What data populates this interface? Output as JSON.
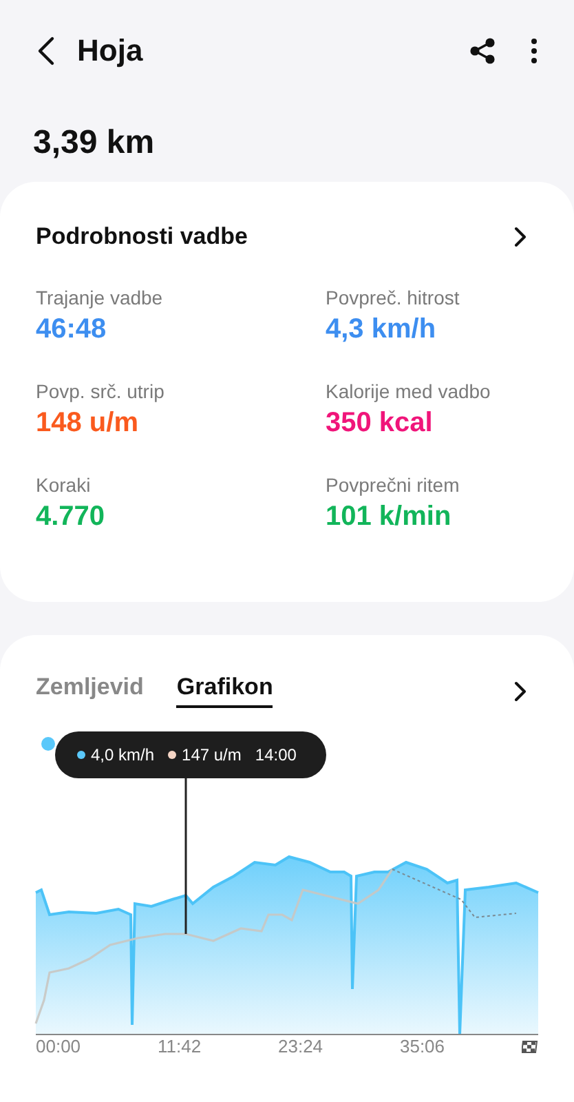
{
  "header": {
    "title": "Hoja"
  },
  "distance": "3,39 km",
  "details": {
    "title": "Podrobnosti vadbe",
    "stats": [
      {
        "label": "Trajanje vadbe",
        "value": "46:48",
        "color": "#3d8ef0"
      },
      {
        "label": "Povpreč. hitrost",
        "value": "4,3 km/h",
        "color": "#3d8ef0"
      },
      {
        "label": "Povp. srč. utrip",
        "value": "148 u/m",
        "color": "#fa5a1e"
      },
      {
        "label": "Kalorije med vadbo",
        "value": "350 kcal",
        "color": "#f0157a"
      },
      {
        "label": "Koraki",
        "value": "4.770",
        "color": "#12b55a"
      },
      {
        "label": "Povprečni ritem",
        "value": "101 k/min",
        "color": "#12b55a"
      }
    ]
  },
  "graph": {
    "tabs": [
      {
        "label": "Zemljevid",
        "selected": false
      },
      {
        "label": "Grafikon",
        "selected": true
      }
    ],
    "tooltip": [
      {
        "text": "4,0 km/h",
        "color": "#5ac8fa"
      },
      {
        "text": "147 u/m",
        "color": "#f5d5c5"
      },
      {
        "text": "14:00"
      }
    ],
    "x_labels": [
      "00:00",
      "11:42",
      "23:24",
      "35:06"
    ]
  }
}
